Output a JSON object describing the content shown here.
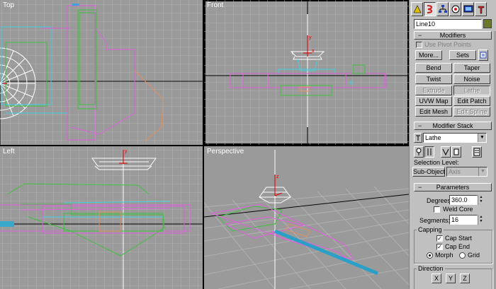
{
  "viewports": {
    "top": {
      "label": "Top"
    },
    "front": {
      "label": "Front"
    },
    "left": {
      "label": "Left"
    },
    "perspective": {
      "label": "Perspective"
    }
  },
  "panel": {
    "object_name": "Line10",
    "object_color": "#6a7a2a",
    "modifiers": {
      "header": "Modifiers",
      "use_pivot_points": "Use Pivot Points",
      "more": "More...",
      "sets": "Sets",
      "buttons": [
        "Bend",
        "Taper",
        "Twist",
        "Noise",
        "Extrude",
        "Lathe",
        "UVW Map",
        "Edit Patch",
        "Edit Mesh",
        "Edit Spline"
      ]
    },
    "stack": {
      "header": "Modifier Stack",
      "current": "Lathe",
      "selection_level": "Selection Level:",
      "sub_object": "Sub-Object",
      "axis": "Axis"
    },
    "parameters": {
      "header": "Parameters",
      "degrees_label": "Degrees:",
      "degrees_value": "360.0",
      "weld_core": "Weld Core",
      "segments_label": "Segments:",
      "segments_value": "16",
      "capping": "Capping",
      "cap_start": "Cap Start",
      "cap_end": "Cap End",
      "morph": "Morph",
      "grid": "Grid",
      "direction": "Direction",
      "x": "X",
      "y": "Y",
      "z": "Z"
    }
  },
  "colors": {
    "grid": "#b0b0b0",
    "viewport_bg": "#9a9a9a",
    "magenta": "#e060e0",
    "green": "#40c040",
    "cyan": "#40d0e0",
    "orange": "#e09060",
    "axis_red": "#e00000",
    "white": "#ffffff"
  }
}
